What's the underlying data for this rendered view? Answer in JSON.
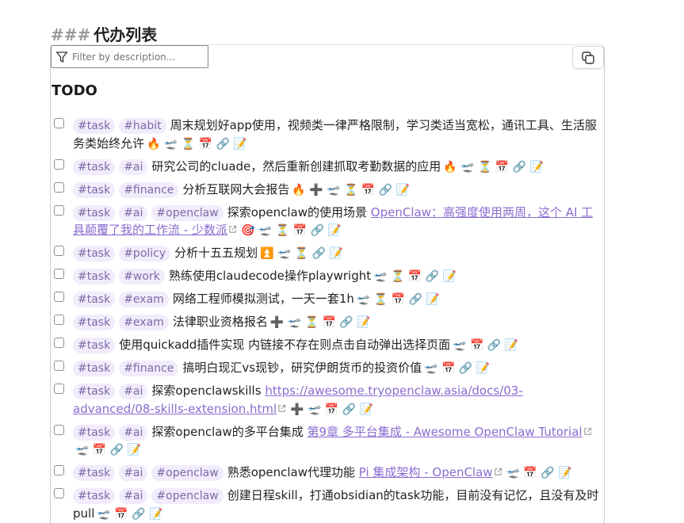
{
  "heading": {
    "hashes": "###",
    "text": "代办列表"
  },
  "filter": {
    "placeholder": "Filter by description..."
  },
  "section_title": "TODO",
  "tasks": [
    {
      "tags": [
        "#task",
        "#habit"
      ],
      "text": "周末规划好app使用，视频类一律严格限制，学习类适当宽松，通讯工具、生活服务类始终允许",
      "link": "",
      "icons": "🔥 🛫 ⏳ 📅 🔗 📝"
    },
    {
      "tags": [
        "#task",
        "#ai"
      ],
      "text": "研究公司的cluade，然后重新创建抓取考勤数据的应用",
      "link": "",
      "icons": "🔥 🛫 ⏳ 📅 🔗 📝"
    },
    {
      "tags": [
        "#task",
        "#finance"
      ],
      "text": "分析互联网大会报告",
      "link": "",
      "icons": "🔥 ➕ 🛫 ⏳ 📅 🔗 📝"
    },
    {
      "tags": [
        "#task",
        "#ai",
        "#openclaw"
      ],
      "text": "探索openclaw的使用场景 ",
      "link": "OpenClaw：高强度使用两周，这个 AI 工具颠覆了我的工作流 - 少数派",
      "icons": "🎯 🛫 ⏳ 📅 🔗 📝"
    },
    {
      "tags": [
        "#task",
        "#policy"
      ],
      "text": "分析十五五规划",
      "link": "",
      "icons": "⏫ 🛫 ⏳ 🔗 📝"
    },
    {
      "tags": [
        "#task",
        "#work"
      ],
      "text": "熟练使用claudecode操作playwright",
      "link": "",
      "icons": "🛫 ⏳ 📅 🔗 📝"
    },
    {
      "tags": [
        "#task",
        "#exam"
      ],
      "text": "网络工程师模拟测试，一天一套1h",
      "link": "",
      "icons": "🛫 ⏳ 📅 🔗 📝"
    },
    {
      "tags": [
        "#task",
        "#exam"
      ],
      "text": "法律职业资格报名",
      "link": "",
      "icons": "➕ 🛫 ⏳ 📅 🔗 📝"
    },
    {
      "tags": [
        "#task"
      ],
      "text": "使用quickadd插件实现 内链接不存在则点击自动弹出选择页面",
      "link": "",
      "icons": "🛫 📅 🔗 📝"
    },
    {
      "tags": [
        "#task",
        "#finance"
      ],
      "text": "搞明白现汇vs现钞，研究伊朗货币的投资价值",
      "link": "",
      "icons": "🛫 📅 🔗 📝"
    },
    {
      "tags": [
        "#task",
        "#ai"
      ],
      "text": "探索openclawskills ",
      "link": "https://awesome.tryopenclaw.asia/docs/03-advanced/08-skills-extension.html",
      "icons": "➕ 🛫 📅 🔗 📝"
    },
    {
      "tags": [
        "#task",
        "#ai"
      ],
      "text": "探索openclaw的多平台集成 ",
      "link": "第9章 多平台集成 - Awesome OpenClaw Tutorial",
      "icons": "🛫 📅 🔗 📝"
    },
    {
      "tags": [
        "#task",
        "#ai",
        "#openclaw"
      ],
      "text": "熟悉openclaw代理功能 ",
      "link": "Pi 集成架构 - OpenClaw",
      "icons": "🛫 📅 🔗 📝"
    },
    {
      "tags": [
        "#task",
        "#ai",
        "#openclaw"
      ],
      "text": "创建日程skill，打通obsidian的task功能，目前没有记忆，且没有及时pull",
      "link": "",
      "icons": "🛫 📅 🔗 📝"
    }
  ]
}
